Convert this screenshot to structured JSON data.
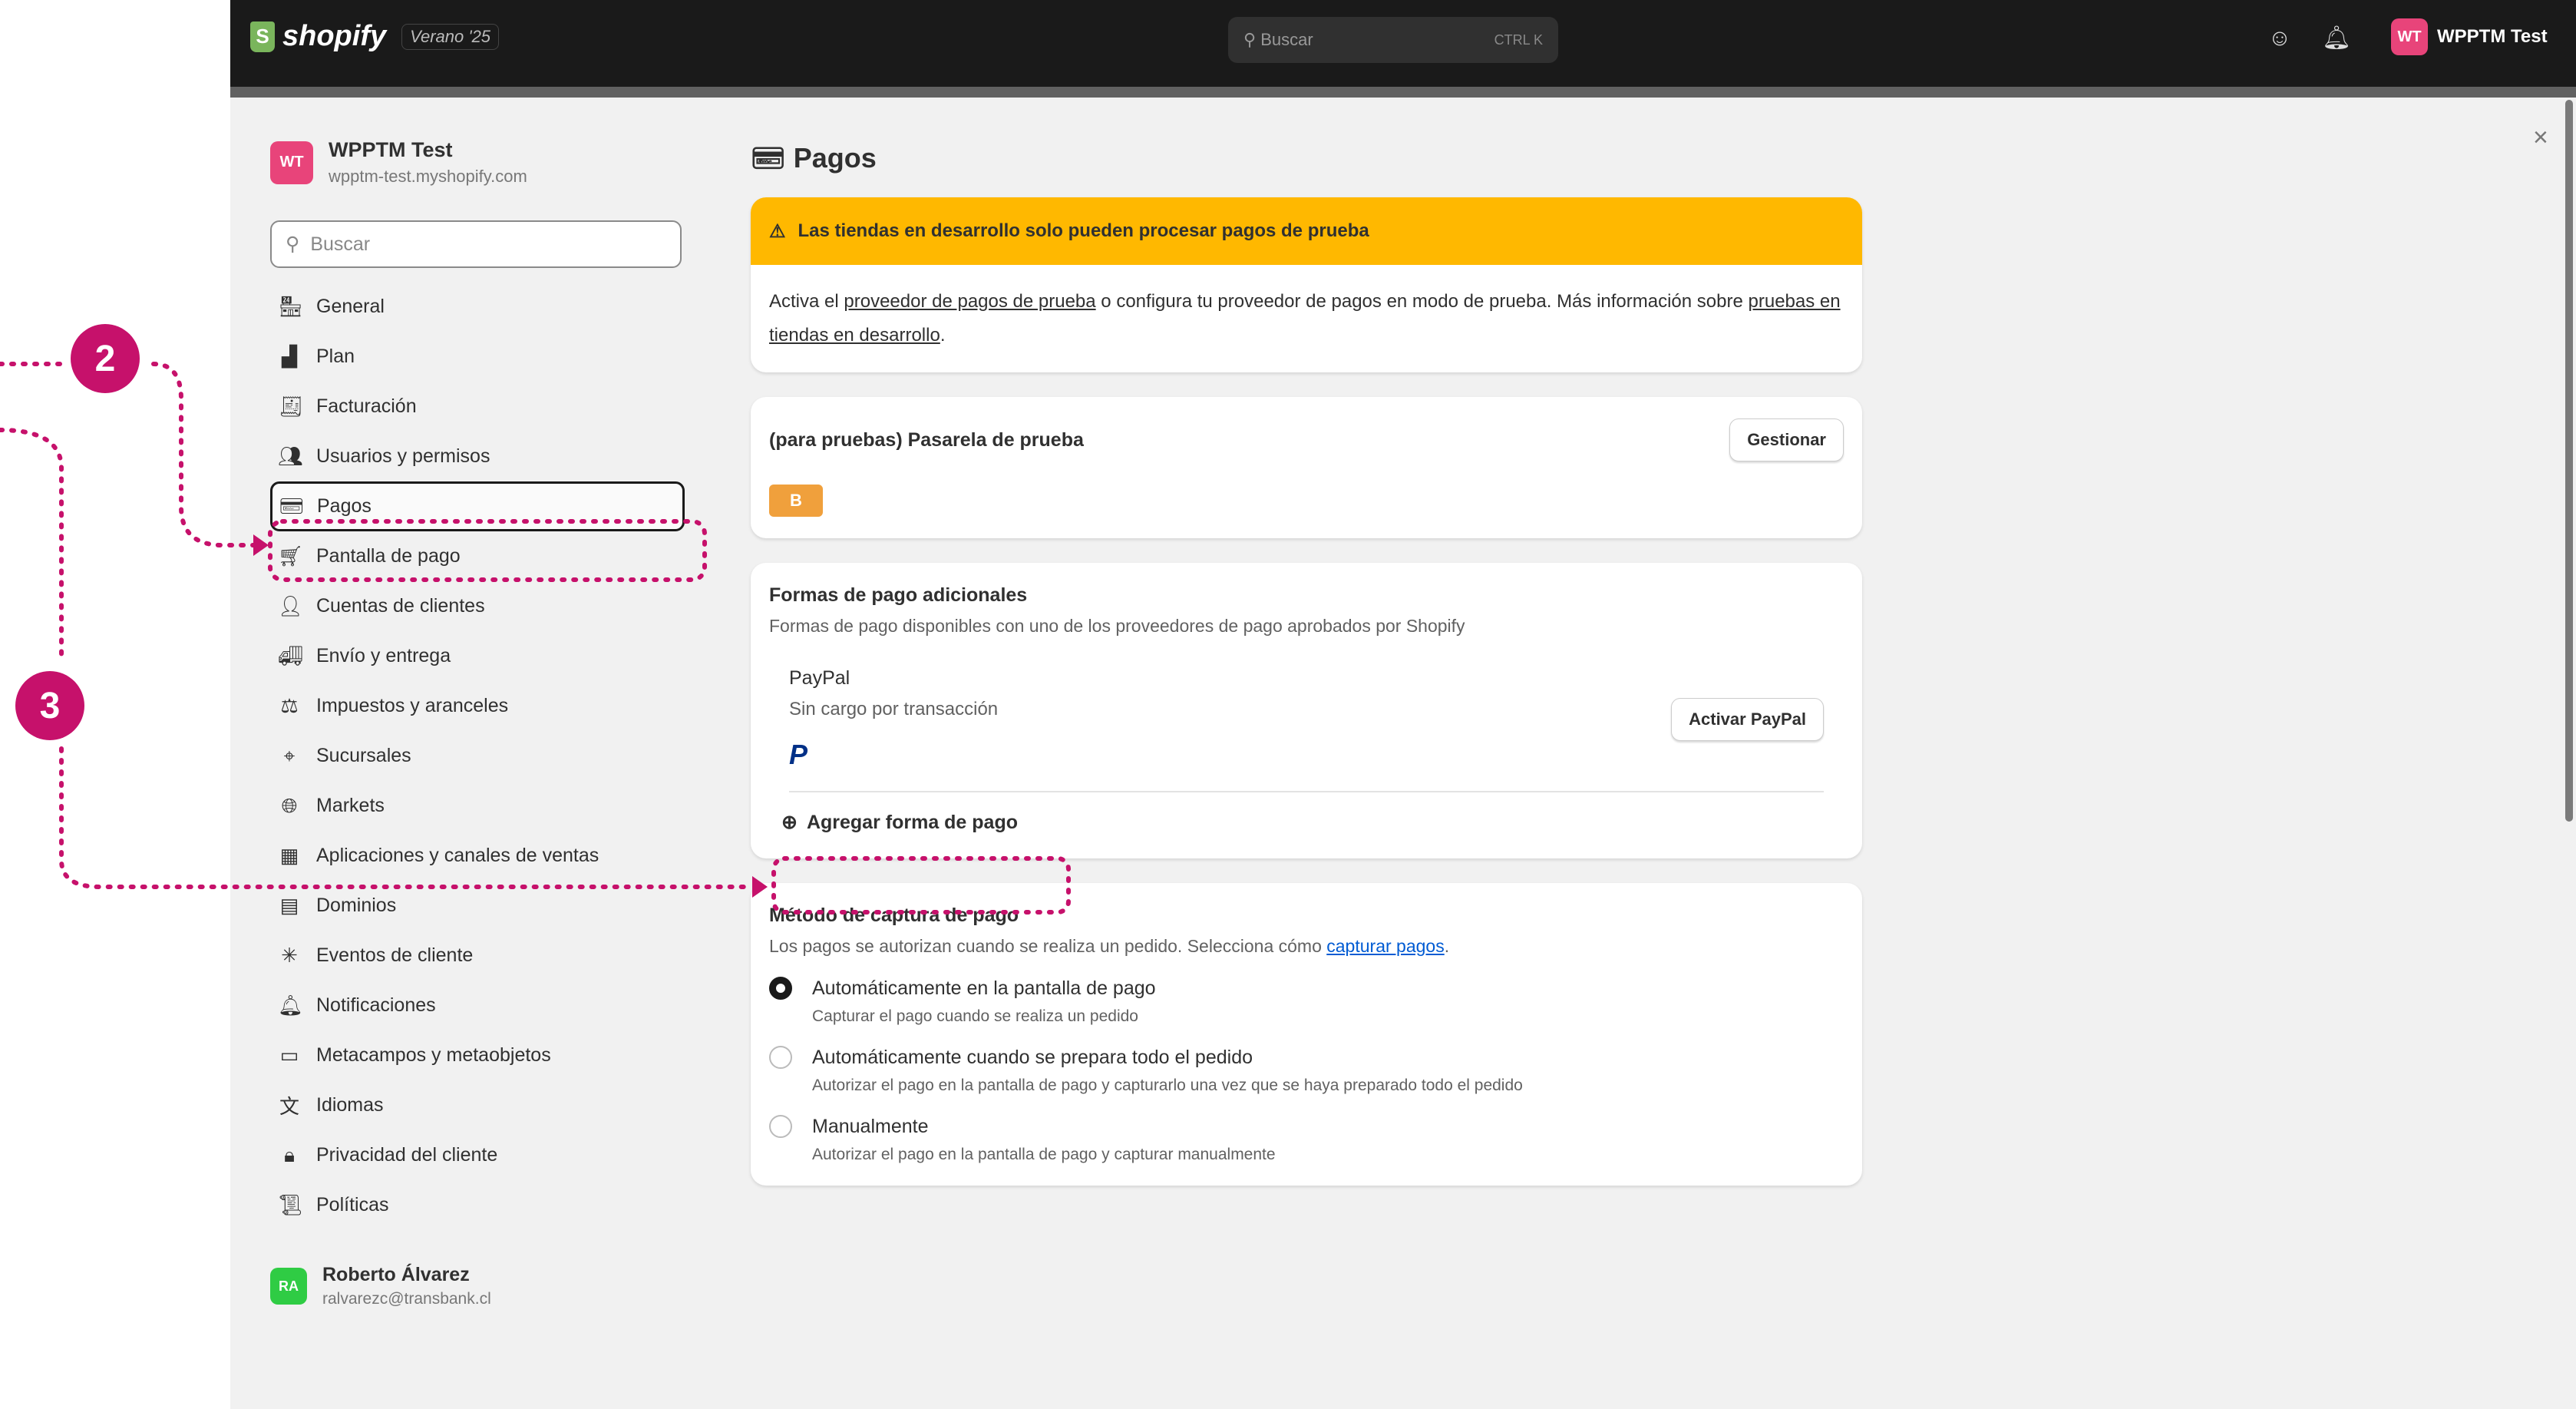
{
  "topbar": {
    "brand": "shopify",
    "edition": "Verano '25",
    "search_placeholder": "Buscar",
    "search_shortcut": "CTRL K",
    "user_initials": "WT",
    "user_name": "WPPTM Test"
  },
  "sidebar": {
    "store_initials": "WT",
    "store_name": "WPPTM Test",
    "store_url": "wpptm-test.myshopify.com",
    "search_placeholder": "Buscar",
    "items": [
      {
        "label": "General",
        "icon": "store-icon"
      },
      {
        "label": "Plan",
        "icon": "chart-icon"
      },
      {
        "label": "Facturación",
        "icon": "receipt-icon"
      },
      {
        "label": "Usuarios y permisos",
        "icon": "users-icon"
      },
      {
        "label": "Pagos",
        "icon": "payments-icon"
      },
      {
        "label": "Pantalla de pago",
        "icon": "cart-icon"
      },
      {
        "label": "Cuentas de clientes",
        "icon": "person-icon"
      },
      {
        "label": "Envío y entrega",
        "icon": "truck-icon"
      },
      {
        "label": "Impuestos y aranceles",
        "icon": "tax-icon"
      },
      {
        "label": "Sucursales",
        "icon": "location-icon"
      },
      {
        "label": "Markets",
        "icon": "globe-icon"
      },
      {
        "label": "Aplicaciones y canales de ventas",
        "icon": "apps-icon"
      },
      {
        "label": "Dominios",
        "icon": "domain-icon"
      },
      {
        "label": "Eventos de cliente",
        "icon": "sparkle-icon"
      },
      {
        "label": "Notificaciones",
        "icon": "bell-icon"
      },
      {
        "label": "Metacampos y metaobjetos",
        "icon": "metafield-icon"
      },
      {
        "label": "Idiomas",
        "icon": "language-icon"
      },
      {
        "label": "Privacidad del cliente",
        "icon": "lock-icon"
      },
      {
        "label": "Políticas",
        "icon": "policy-icon"
      }
    ],
    "bottom_user_initials": "RA",
    "bottom_user_name": "Roberto Álvarez",
    "bottom_user_email": "ralvarezc@transbank.cl"
  },
  "main": {
    "title": "Pagos",
    "banner": {
      "title": "Las tiendas en desarrollo solo pueden procesar pagos de prueba",
      "text_1": "Activa el ",
      "link_1": "proveedor de pagos de prueba",
      "text_2": " o configura tu proveedor de pagos en modo de prueba. Más información sobre ",
      "link_2": "pruebas en tiendas en desarrollo",
      "text_3": "."
    },
    "gateway": {
      "title": "(para pruebas) Pasarela de prueba",
      "button": "Gestionar",
      "badge": "B"
    },
    "additional": {
      "title": "Formas de pago adicionales",
      "subtitle": "Formas de pago disponibles con uno de los proveedores de pago aprobados por Shopify",
      "paypal_name": "PayPal",
      "paypal_sub": "Sin cargo por transacción",
      "paypal_logo": "P",
      "paypal_button": "Activar PayPal",
      "add_label": "Agregar forma de pago"
    },
    "capture": {
      "title": "Método de captura de pago",
      "desc_1": "Los pagos se autorizan cuando se realiza un pedido. Selecciona cómo ",
      "desc_link": "capturar pagos",
      "desc_2": ".",
      "options": [
        {
          "label": "Automáticamente en la pantalla de pago",
          "help": "Capturar el pago cuando se realiza un pedido",
          "selected": true
        },
        {
          "label": "Automáticamente cuando se prepara todo el pedido",
          "help": "Autorizar el pago en la pantalla de pago y capturarlo una vez que se haya preparado todo el pedido",
          "selected": false
        },
        {
          "label": "Manualmente",
          "help": "Autorizar el pago en la pantalla de pago y capturar manualmente",
          "selected": false
        }
      ]
    }
  },
  "annotations": {
    "step_2": "2",
    "step_3": "3",
    "color": "#c6116b"
  }
}
